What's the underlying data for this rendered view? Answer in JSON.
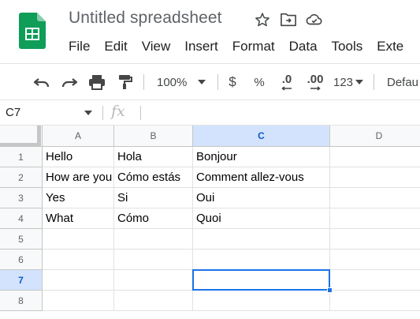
{
  "app": {
    "title": "Untitled spreadsheet",
    "brand_color": "#0f9d58"
  },
  "title_icons": [
    "star-icon",
    "move-to-folder-icon",
    "cloud-status-icon"
  ],
  "menu": [
    "File",
    "Edit",
    "View",
    "Insert",
    "Format",
    "Data",
    "Tools",
    "Exte"
  ],
  "toolbar": {
    "zoom": "100%",
    "currency": "$",
    "percent": "%",
    "decrease_decimal": ".0",
    "increase_decimal": ".00",
    "number_format": "123",
    "font": "Defau"
  },
  "formula_bar": {
    "cell_ref": "C7",
    "fx": "fx",
    "content": ""
  },
  "grid": {
    "columns": [
      "A",
      "B",
      "C",
      "D"
    ],
    "rows": [
      "1",
      "2",
      "3",
      "4",
      "5",
      "6",
      "7",
      "8"
    ],
    "active_column": "C",
    "active_row": "7",
    "cells": [
      [
        "Hello",
        "Hola",
        "Bonjour",
        ""
      ],
      [
        "How are you",
        "Cómo estás",
        "Comment allez-vous",
        ""
      ],
      [
        "Yes",
        "Si",
        "Oui",
        ""
      ],
      [
        "What",
        "Cómo",
        "Quoi",
        ""
      ],
      [
        "",
        "",
        "",
        ""
      ],
      [
        "",
        "",
        "",
        ""
      ],
      [
        "",
        "",
        "",
        ""
      ],
      [
        "",
        "",
        "",
        ""
      ]
    ],
    "selection_color": "#1a73e8"
  }
}
